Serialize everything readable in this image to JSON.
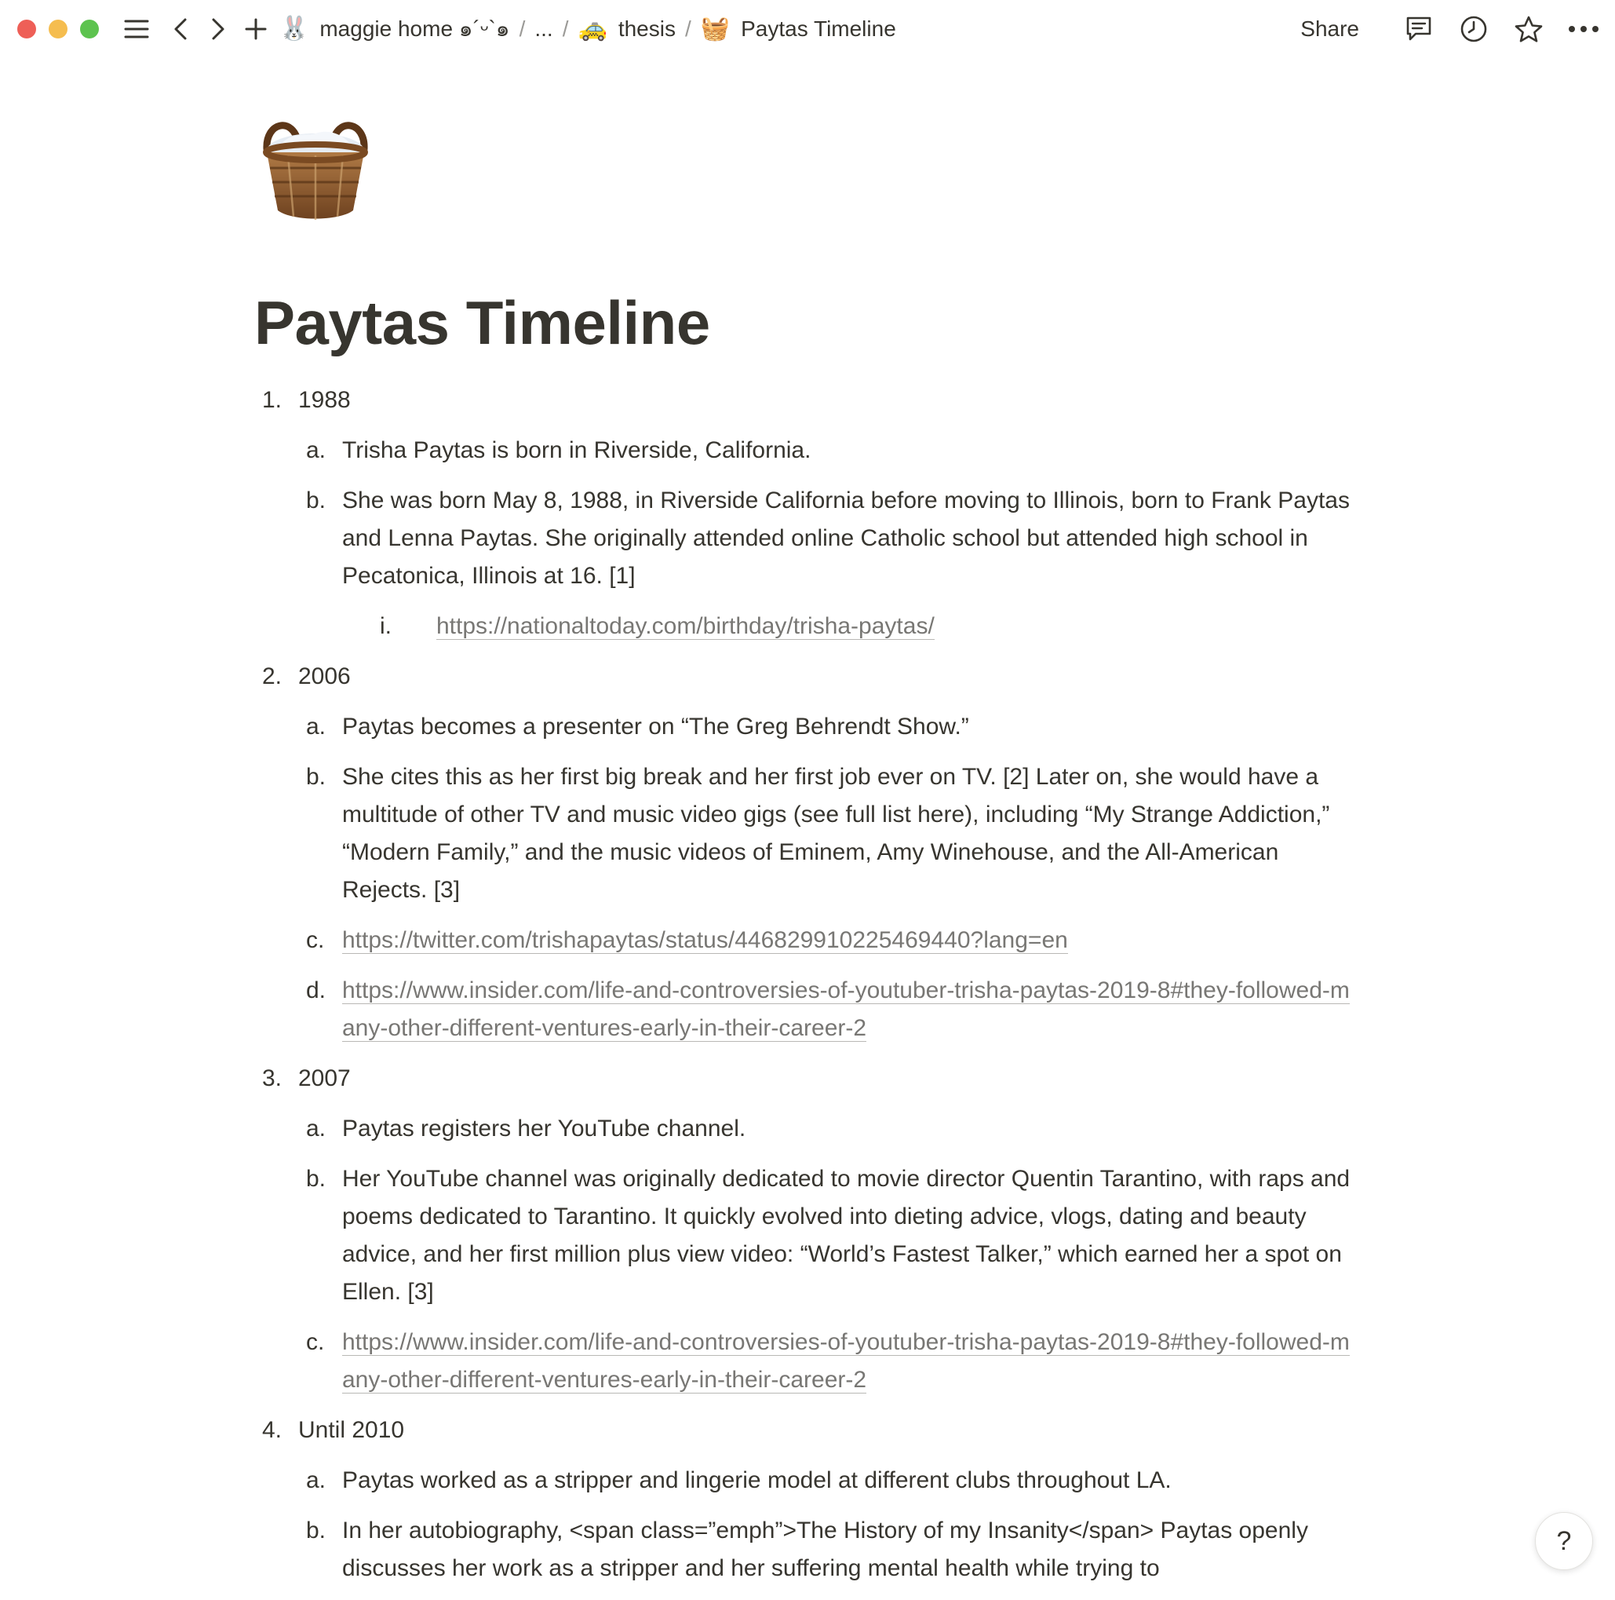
{
  "breadcrumbs": [
    {
      "emoji": "🐰",
      "label": "maggie home ๑´ᵕ`๑"
    },
    {
      "emoji": "",
      "label": "..."
    },
    {
      "emoji": "🚕",
      "label": "thesis"
    },
    {
      "emoji": "🧺",
      "label": "Paytas Timeline"
    }
  ],
  "separator": "/",
  "actions": {
    "share_label": "Share"
  },
  "page": {
    "title": "Paytas Timeline",
    "icon": "basket-icon"
  },
  "timeline": [
    {
      "marker": "1.",
      "year": "1988",
      "items": [
        {
          "marker": "a.",
          "text": "Trisha Paytas is born in Riverside, California."
        },
        {
          "marker": "b.",
          "text": "She was born May 8, 1988, in Riverside California before moving to Illinois, born to Frank Paytas and Lenna Paytas. She originally attended online Catholic school but attended high school in Pecatonica, Illinois at 16. [1]"
        }
      ],
      "sub_items": [
        {
          "marker": "i.",
          "link": "https://nationaltoday.com/birthday/trisha-paytas/"
        }
      ]
    },
    {
      "marker": "2.",
      "year": "2006",
      "items": [
        {
          "marker": "a.",
          "text": "Paytas becomes a presenter on “The Greg Behrendt Show.”"
        },
        {
          "marker": "b.",
          "text": "She cites this as her first big break and her first job ever on TV. [2] Later on, she would have a multitude of other TV and music video gigs (see full list here), including “My Strange Addiction,” “Modern Family,” and the music videos of Eminem, Amy Winehouse, and the All-American Rejects. [3]"
        },
        {
          "marker": "c.",
          "link": "https://twitter.com/trishapaytas/status/446829910225469440?lang=en"
        },
        {
          "marker": "d.",
          "link": "https://www.insider.com/life-and-controversies-of-youtuber-trisha-paytas-2019-8#they-followed-many-other-different-ventures-early-in-their-career-2"
        }
      ]
    },
    {
      "marker": "3.",
      "year": "2007",
      "items": [
        {
          "marker": "a.",
          "text": "Paytas registers her YouTube channel."
        },
        {
          "marker": "b.",
          "text": "Her YouTube channel was originally dedicated to movie director Quentin Tarantino, with raps and poems dedicated to Tarantino. It quickly evolved into dieting advice, vlogs, dating and beauty advice, and her first million plus view video: “World’s Fastest Talker,” which earned her a spot on Ellen. [3]"
        },
        {
          "marker": "c.",
          "link": "https://www.insider.com/life-and-controversies-of-youtuber-trisha-paytas-2019-8#they-followed-many-other-different-ventures-early-in-their-career-2"
        }
      ]
    },
    {
      "marker": "4.",
      "year": "Until 2010",
      "items": [
        {
          "marker": "a.",
          "text": "Paytas worked as a stripper and lingerie model at different clubs throughout LA."
        },
        {
          "marker": "b.",
          "text": "In her autobiography, <span class=”emph”>The History of my Insanity</span> Paytas openly discusses her work as a stripper and her suffering mental health while trying to"
        }
      ]
    }
  ],
  "help": {
    "label": "?"
  }
}
